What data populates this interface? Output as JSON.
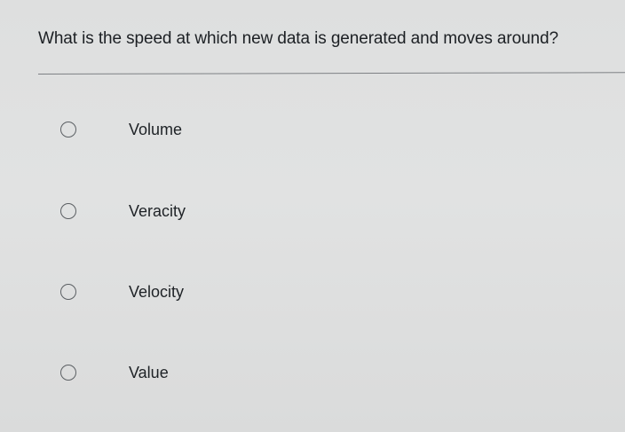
{
  "question": {
    "text": "What is the speed at which new data is generated and moves around?"
  },
  "options": [
    {
      "label": "Volume",
      "selected": false
    },
    {
      "label": "Veracity",
      "selected": false
    },
    {
      "label": "Velocity",
      "selected": false
    },
    {
      "label": "Value",
      "selected": false
    }
  ]
}
